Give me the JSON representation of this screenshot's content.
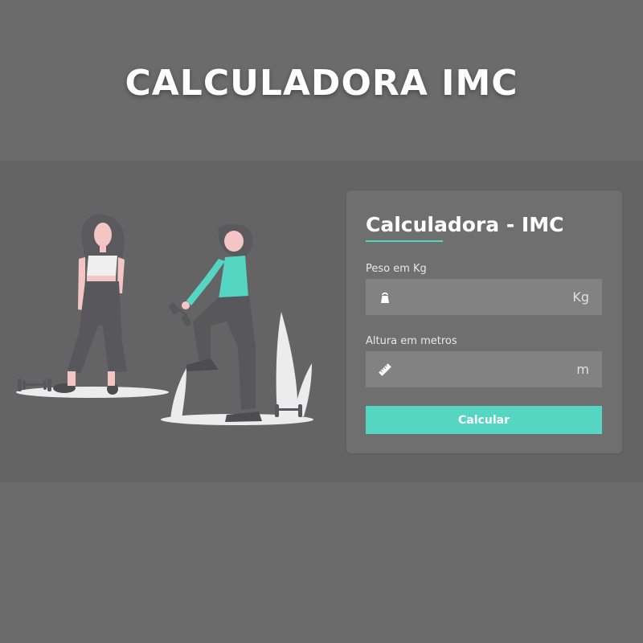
{
  "banner": {
    "title": "CALCULADORA IMC"
  },
  "form": {
    "title": "Calculadora - IMC",
    "weight": {
      "label": "Peso em Kg",
      "value": "",
      "placeholder": "",
      "unit": "Kg"
    },
    "height": {
      "label": "Altura em metros",
      "value": "",
      "placeholder": "",
      "unit": "m"
    },
    "submit_label": "Calcular"
  },
  "icons": {
    "weight": "kettlebell-icon",
    "height": "ruler-icon"
  },
  "colors": {
    "page_background": "#6b6b6b",
    "band_background": "#646465",
    "card_background": "#6f6f70",
    "input_background": "#828283",
    "accent": "#55d6c3",
    "text": "#ffffff"
  }
}
